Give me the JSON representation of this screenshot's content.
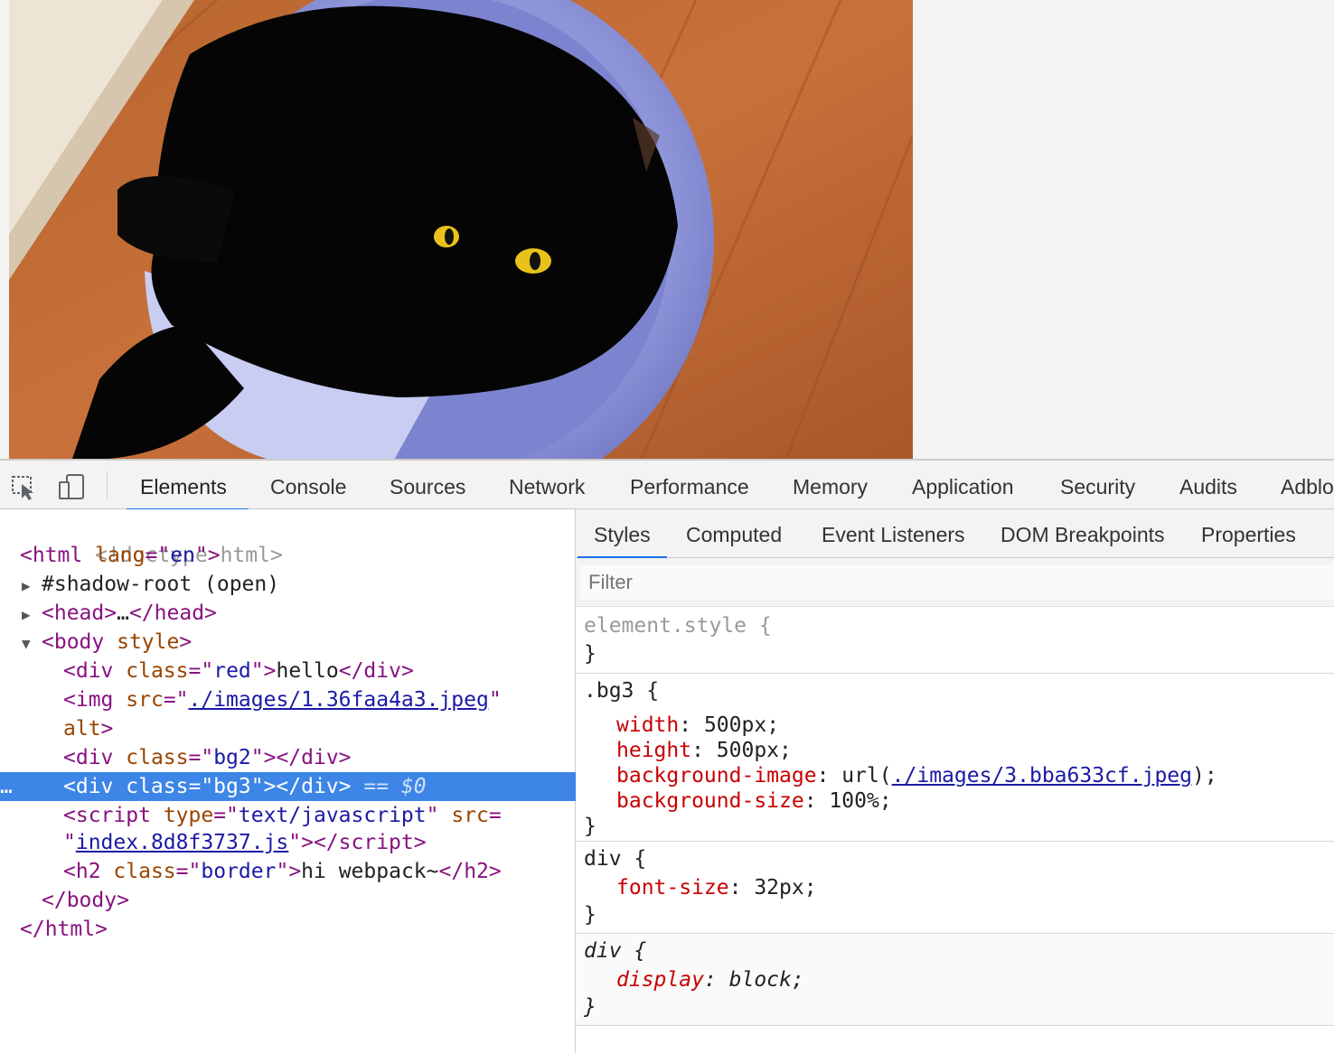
{
  "devtools": {
    "tabs": [
      "Elements",
      "Console",
      "Sources",
      "Network",
      "Performance",
      "Memory",
      "Application",
      "Security",
      "Audits",
      "Adblo"
    ],
    "active_tab": "Elements",
    "icons": [
      "inspect-element-icon",
      "device-toolbar-icon"
    ],
    "accent_color": "#1a73e8"
  },
  "elements": {
    "doctype": "<!doctype html>",
    "html_open_tag": "html",
    "html_lang_attr": "lang",
    "html_lang_val": "en",
    "shadow_root": "#shadow-root (open)",
    "head_open": "<head>",
    "head_ellipsis": "…",
    "head_close": "</head>",
    "body_open": "<body",
    "body_attr": "style",
    "body_close_bracket": ">",
    "div_red_tag": "div",
    "div_red_class_attr": "class",
    "div_red_class_val": "red",
    "div_red_text": "hello",
    "img_tag": "img",
    "img_src_attr": "src",
    "img_src_val": "./images/1.36faa4a3.jpeg",
    "img_alt_attr": "alt",
    "div_bg2_class_val": "bg2",
    "div_bg3_text": "<div class=\"bg3\"></div>",
    "selected_marker": "== $0",
    "ellipsis": "…",
    "script_tag": "script",
    "script_type_attr": "type",
    "script_type_val": "text/javascript",
    "script_src_attr": "src",
    "script_src_val": "index.8d8f3737.js",
    "h2_tag": "h2",
    "h2_class_val": "border",
    "h2_text": "hi webpack~",
    "body_close": "</body>",
    "html_close": "</html>"
  },
  "styles": {
    "subtabs": [
      "Styles",
      "Computed",
      "Event Listeners",
      "DOM Breakpoints",
      "Properties"
    ],
    "active_subtab": "Styles",
    "filter_placeholder": "Filter",
    "rules": [
      {
        "selector": "element.style {",
        "declarations": [],
        "close": "}"
      },
      {
        "selector": ".bg3 {",
        "declarations": [
          {
            "prop": "width",
            "value": "500px"
          },
          {
            "prop": "height",
            "value": "500px"
          },
          {
            "prop": "background-image",
            "value_prefix": "url(",
            "value_link": "./images/3.bba633cf.jpeg",
            "value_suffix": ")"
          },
          {
            "prop": "background-size",
            "value": "100%"
          }
        ],
        "close": "}"
      },
      {
        "selector": "div {",
        "declarations": [
          {
            "prop": "font-size",
            "value": "32px"
          }
        ],
        "close": "}"
      },
      {
        "selector": "div {",
        "declarations": [
          {
            "prop": "display",
            "value": "block"
          }
        ],
        "close": "}"
      }
    ]
  }
}
